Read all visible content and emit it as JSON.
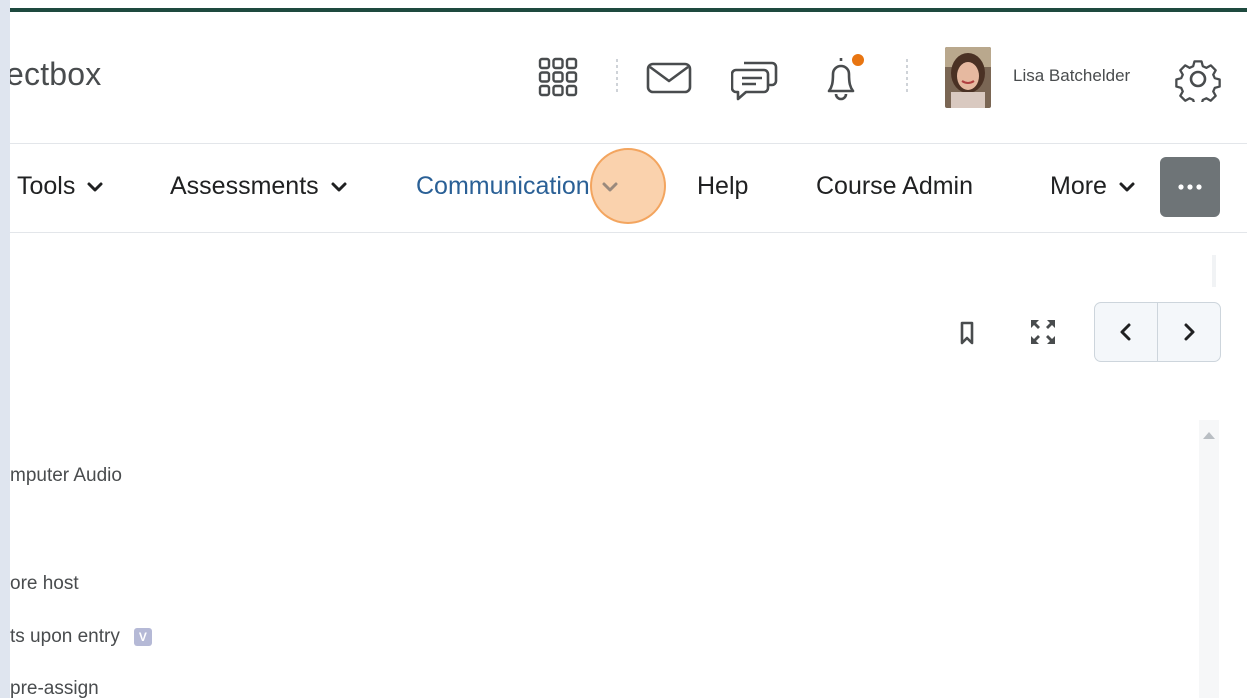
{
  "header": {
    "brand_fragment": "ectbox",
    "user_name": "Lisa Batchelder",
    "icons": [
      "apps-grid-icon",
      "mail-icon",
      "chat-icon",
      "bell-icon",
      "gear-icon"
    ],
    "notification_color": "#e87511"
  },
  "nav": {
    "items": [
      {
        "label": "Tools",
        "dropdown": true
      },
      {
        "label": "Assessments",
        "dropdown": true
      },
      {
        "label": "Communication",
        "dropdown": true,
        "active": true
      },
      {
        "label": "Help",
        "dropdown": false
      },
      {
        "label": "Course Admin",
        "dropdown": false
      },
      {
        "label": "More",
        "dropdown": true
      }
    ],
    "more_button": "···",
    "active_color": "#2a6096"
  },
  "toolbar": {
    "icons": [
      "bookmark-icon",
      "fullscreen-icon",
      "chevron-left-icon",
      "chevron-right-icon"
    ]
  },
  "content": {
    "lines": [
      "mputer Audio",
      "ore host",
      "ts upon entry",
      "pre-assign"
    ],
    "badge_letter": "V"
  },
  "colors": {
    "top_stripe": "#1e4a3f",
    "more_button_bg": "#6e7477",
    "click_marker": "#f6ad69"
  }
}
